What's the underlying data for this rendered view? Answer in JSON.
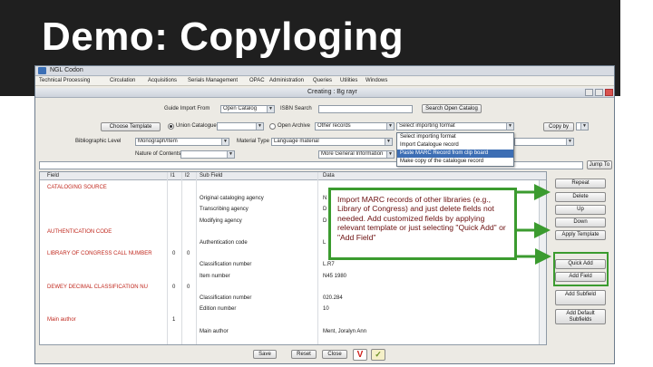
{
  "slide": {
    "title": "Demo: Copyloging"
  },
  "window": {
    "title": "NGL Codon",
    "menu": [
      "Technical Processing",
      "Circulation",
      "Acquisitions",
      "Serials Management",
      "OPAC",
      "Administration",
      "Queries",
      "Utilities",
      "Windows"
    ]
  },
  "inner_window": {
    "title": "Creating : Bg rayr"
  },
  "search": {
    "guide_label": "Guide Import From",
    "guide_value": "Open Catalog",
    "isbn_label": "ISBN Search",
    "isbn_value": "",
    "search_open_catalog": "Search Open Catalog"
  },
  "template": {
    "choose_template": "Choose Template",
    "union_catalogue": "Union Catalogue",
    "open_archive": "Open Archive",
    "other_records": "Other records",
    "import_format_value": "Select importing format",
    "copy_by": "Copy by"
  },
  "bib": {
    "level_label": "Bibliographic Level",
    "level_value": "Monograph/Item",
    "material_label": "Material Type",
    "material_value": "Language material",
    "nature_label": "Nature of Contents",
    "standard_label": "More General Information"
  },
  "import_menu": {
    "items": [
      "Select importing format",
      "Import Catalogue record",
      "Paste MARC Record from clip board",
      "Make copy of the catalogue record"
    ],
    "selected_index": 2
  },
  "jump_to": "Jump To",
  "grid": {
    "headers": [
      "Field",
      "I1",
      "I2",
      "Sub Field",
      "Data"
    ],
    "rows": [
      {
        "field": "CATALOGING SOURCE",
        "i1": "",
        "i2": "",
        "sub": "",
        "data": ""
      },
      {
        "field": "",
        "i1": "",
        "i2": "",
        "sub": "Original cataloging agency",
        "data": "N"
      },
      {
        "field": "",
        "i1": "",
        "i2": "",
        "sub": "Transcribing agency",
        "data": "D"
      },
      {
        "field": "",
        "i1": "",
        "i2": "",
        "sub": "Modifying agency",
        "data": "D"
      },
      {
        "field": "AUTHENTICATION CODE",
        "i1": "",
        "i2": "",
        "sub": "",
        "data": ""
      },
      {
        "field": "",
        "i1": "",
        "i2": "",
        "sub": "Authentication code",
        "data": "L"
      },
      {
        "field": "LIBRARY OF CONGRESS CALL NUMBER",
        "i1": "0",
        "i2": "0",
        "sub": "",
        "data": ""
      },
      {
        "field": "",
        "i1": "",
        "i2": "",
        "sub": "Classification number",
        "data": "L.R7"
      },
      {
        "field": "",
        "i1": "",
        "i2": "",
        "sub": "Item number",
        "data": "N45 1980"
      },
      {
        "field": "DEWEY DECIMAL CLASSIFICATION NU",
        "i1": "0",
        "i2": "0",
        "sub": "",
        "data": ""
      },
      {
        "field": "",
        "i1": "",
        "i2": "",
        "sub": "Classification number",
        "data": "020.284"
      },
      {
        "field": "",
        "i1": "",
        "i2": "",
        "sub": "Edition number",
        "data": "10"
      },
      {
        "field": "Main author",
        "i1": "1",
        "i2": "",
        "sub": "",
        "data": ""
      },
      {
        "field": "",
        "i1": "",
        "i2": "",
        "sub": "Main author",
        "data": "Ment, Joralyn Ann"
      }
    ]
  },
  "right_buttons": [
    "Repeat",
    "Delete",
    "Up",
    "Down",
    "Apply Template",
    "Quick Add",
    "Add Field",
    "Add Subfield",
    "Add Default Subfields"
  ],
  "bottom": {
    "save": "Save",
    "reset": "Reset",
    "close": "Close",
    "v_icon": "V",
    "check_icon": "✓"
  },
  "callout": {
    "text": "Import MARC records of other libraries (e.g., Library of Congress) and just delete fields not needed. Add customized fields by applying relevant template or just selecting \"Quick Add\" or \"Add Field\"",
    "color": "#3b9b2f"
  }
}
